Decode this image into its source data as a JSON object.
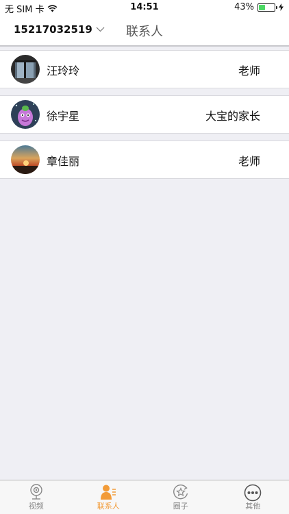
{
  "status_bar": {
    "carrier": "无 SIM 卡",
    "time": "14:51",
    "battery_percent": "43%",
    "battery_level": 0.43
  },
  "nav": {
    "account": "15217032519",
    "title": "联系人"
  },
  "contacts": [
    {
      "name": "汪玲玲",
      "role": "老师",
      "avatar": "building-photo"
    },
    {
      "name": "徐宇星",
      "role": "大宝的家长",
      "avatar": "purple-cartoon"
    },
    {
      "name": "章佳丽",
      "role": "老师",
      "avatar": "sunset-photo"
    }
  ],
  "tabs": [
    {
      "label": "视频",
      "icon": "camera-icon",
      "active": false
    },
    {
      "label": "联系人",
      "icon": "contacts-icon",
      "active": true
    },
    {
      "label": "圈子",
      "icon": "star-circle-icon",
      "active": false
    },
    {
      "label": "其他",
      "icon": "more-icon",
      "active": false
    }
  ],
  "colors": {
    "accent": "#f29b38",
    "tab_inactive": "#888888",
    "background": "#efeff4",
    "battery": "#4cd964"
  }
}
